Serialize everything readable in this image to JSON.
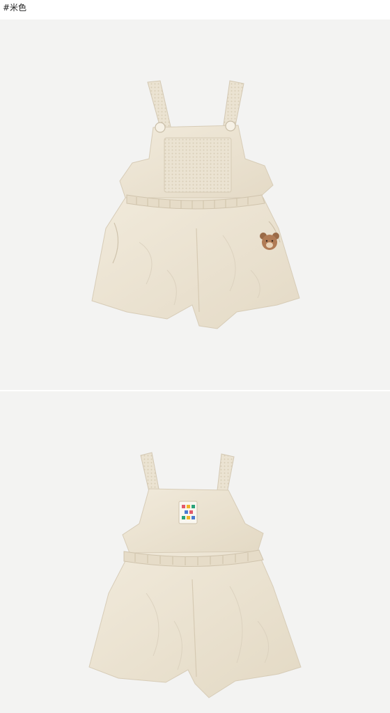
{
  "caption": {
    "text": "#米色"
  },
  "colors": {
    "page_background": "#ffffff",
    "panel_background": "#f3f3f2",
    "fabric": "#ece4d3",
    "fabric_shadow": "#d9cfbb",
    "button": "#f6f1e6",
    "bear_patch": "#b07b55"
  },
  "product_views": [
    {
      "view": "front",
      "icons": [
        "bear-patch-icon",
        "strap-button-icon"
      ]
    },
    {
      "view": "back",
      "icons": [
        "brand-label-icon"
      ]
    }
  ]
}
